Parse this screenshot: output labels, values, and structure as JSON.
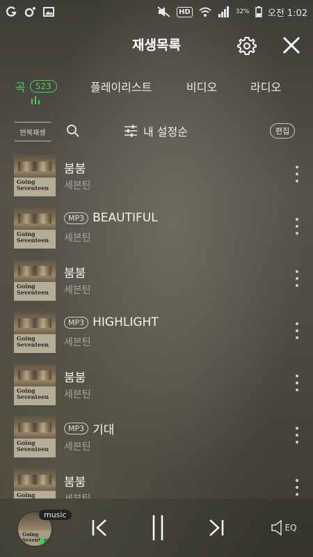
{
  "status_bar": {
    "battery_percent": "32%",
    "hd_label": "HD",
    "time": "오전 1:02"
  },
  "header": {
    "title": "재생목록"
  },
  "tabs": [
    {
      "label": "곡",
      "count": "523",
      "active": true
    },
    {
      "label": "플레이리스트",
      "active": false
    },
    {
      "label": "비디오",
      "active": false
    },
    {
      "label": "라디오",
      "active": false
    }
  ],
  "toolbar": {
    "repeat_label": "반복재생",
    "sort_label": "내 설정순",
    "edit_label": "편집"
  },
  "album_cover_text": "Going Seventeen",
  "songs": [
    {
      "title": "붐붐",
      "artist": "세븐틴",
      "badge": ""
    },
    {
      "title": "BEAUTIFUL",
      "artist": "세븐틴",
      "badge": "MP3"
    },
    {
      "title": "붐붐",
      "artist": "세븐틴",
      "badge": ""
    },
    {
      "title": "HIGHLIGHT",
      "artist": "세븐틴",
      "badge": "MP3"
    },
    {
      "title": "붐붐",
      "artist": "세븐틴",
      "badge": ""
    },
    {
      "title": "기대",
      "artist": "세븐틴",
      "badge": "MP3"
    },
    {
      "title": "붐붐",
      "artist": "세븐틴",
      "badge": ""
    }
  ],
  "player": {
    "badge": "music",
    "eq_label": "EQ"
  },
  "colors": {
    "accent_green": "#4cd05a",
    "text_primary": "#f3f3f3",
    "text_secondary": "#a7a69d"
  },
  "icons": {
    "settings": "gear-icon",
    "close": "close-icon",
    "search": "search-icon",
    "sort": "sliders-icon",
    "more": "more-vertical-icon",
    "prev": "skip-previous-icon",
    "pause": "pause-icon",
    "next": "skip-next-icon",
    "eq": "equalizer-speaker-icon"
  }
}
